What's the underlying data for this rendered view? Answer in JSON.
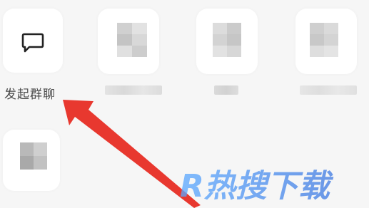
{
  "grid": {
    "start_group_chat": {
      "label": "发起群聊",
      "icon": "chat-bubble-icon"
    },
    "hidden_items": [
      {
        "icon": "pixelated-icon",
        "label_obscured": true
      },
      {
        "icon": "pixelated-icon",
        "label_obscured": true
      },
      {
        "icon": "pixelated-icon",
        "label_obscured": true
      },
      {
        "icon": "pixelated-icon",
        "label_obscured": true
      }
    ]
  },
  "annotation": {
    "type": "arrow-pointer",
    "color": "#e8382f"
  },
  "watermark": {
    "text": "R热搜下载",
    "color": "#4a8ff0"
  }
}
